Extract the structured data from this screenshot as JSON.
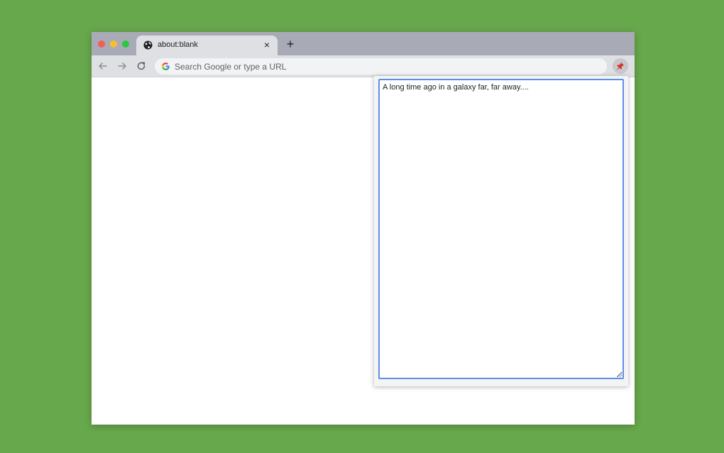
{
  "browser": {
    "tab": {
      "title": "about:blank",
      "close_glyph": "×",
      "favicon": "globe-icon"
    },
    "new_tab_glyph": "+",
    "toolbar": {
      "back_icon": "arrow-left-icon",
      "forward_icon": "arrow-right-icon",
      "reload_icon": "reload-icon",
      "omnibox_placeholder": "Search Google or type a URL",
      "omnibox_icon": "google-g-icon",
      "extension_icon": "pushpin-icon"
    }
  },
  "popup": {
    "note_text": "A long time ago in a galaxy far, far away....",
    "border_color": "#5b8fe8"
  },
  "colors": {
    "background": "#68a84c",
    "titlebar": "#a8abb5",
    "toolbar": "#dfe0e4"
  }
}
